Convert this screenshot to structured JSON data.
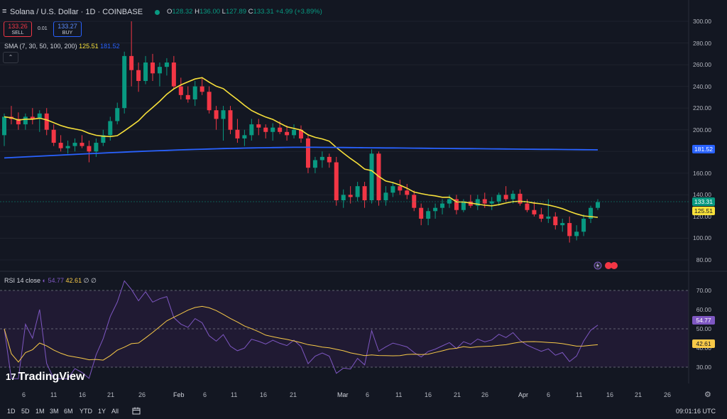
{
  "header": {
    "menu_icon": "≡",
    "title": "Solana / U.S. Dollar · 1D · COINBASE",
    "ohlc": {
      "o_label": "O",
      "o": "128.32",
      "h_label": "H",
      "h": "136.00",
      "l_label": "L",
      "l": "127.89",
      "c_label": "C",
      "c": "133.31",
      "change": "+4.99 (+3.89%)"
    }
  },
  "trade": {
    "sell_price": "133.26",
    "sell_label": "SELL",
    "spread": "0.01",
    "buy_price": "133.27",
    "buy_label": "BUY"
  },
  "sma_legend": {
    "label": "SMA (7, 30, 50, 100, 200)",
    "value1": "125.51",
    "value2": "181.52"
  },
  "rsi_legend": {
    "label": "RSI 14 close",
    "value1": "54.77",
    "value2": "42.61",
    "value3": "∅",
    "value4": "∅"
  },
  "collapse_icon": "⌃",
  "price_axis": [
    "300.00",
    "280.00",
    "260.00",
    "240.00",
    "220.00",
    "200.00",
    "180.00",
    "160.00",
    "140.00",
    "120.00",
    "100.00",
    "80.00"
  ],
  "price_badges": {
    "sma200": "181.52",
    "close": "133.31",
    "sma30": "125.51"
  },
  "rsi_axis": [
    "70.00",
    "60.00",
    "50.00",
    "40.00",
    "30.00"
  ],
  "rsi_badges": {
    "rsi": "54.77",
    "rsi_ma": "42.61"
  },
  "time_axis": [
    "6",
    "11",
    "16",
    "21",
    "26",
    "Feb",
    "6",
    "11",
    "16",
    "21",
    "Mar",
    "6",
    "11",
    "16",
    "21",
    "26",
    "Apr",
    "6",
    "11",
    "16",
    "21",
    "26"
  ],
  "timeframes": [
    "1D",
    "5D",
    "1M",
    "3M",
    "6M",
    "YTD",
    "1Y",
    "All"
  ],
  "calendar_icon": "calendar-range-icon",
  "clock": "09:01:16 UTC",
  "logo": {
    "mark": "17",
    "text": "TradingView"
  },
  "settings_icon": "⚙",
  "colors": {
    "bg": "#131722",
    "up": "#089981",
    "down": "#f23645",
    "sma30": "#f7e03a",
    "sma200": "#2962ff",
    "rsi": "#7e57c2",
    "rsi_ma": "#f7c948"
  },
  "chart_data": {
    "type": "candlestick",
    "title": "Solana / U.S. Dollar · 1D · COINBASE",
    "ylim": [
      70,
      310
    ],
    "candles": [
      [
        195,
        215,
        185,
        212
      ],
      [
        212,
        222,
        205,
        210
      ],
      [
        210,
        216,
        200,
        205
      ],
      [
        205,
        215,
        200,
        212
      ],
      [
        212,
        220,
        205,
        210
      ],
      [
        210,
        218,
        198,
        215
      ],
      [
        215,
        220,
        195,
        200
      ],
      [
        200,
        205,
        185,
        188
      ],
      [
        188,
        195,
        180,
        183
      ],
      [
        183,
        190,
        178,
        185
      ],
      [
        185,
        192,
        180,
        188
      ],
      [
        188,
        195,
        183,
        185
      ],
      [
        185,
        190,
        170,
        180
      ],
      [
        180,
        192,
        175,
        188
      ],
      [
        188,
        200,
        185,
        195
      ],
      [
        195,
        212,
        190,
        208
      ],
      [
        208,
        225,
        205,
        220
      ],
      [
        220,
        272,
        215,
        268
      ],
      [
        268,
        300,
        240,
        255
      ],
      [
        255,
        262,
        235,
        245
      ],
      [
        245,
        268,
        242,
        262
      ],
      [
        262,
        270,
        245,
        252
      ],
      [
        252,
        262,
        240,
        258
      ],
      [
        258,
        266,
        250,
        262
      ],
      [
        262,
        268,
        238,
        240
      ],
      [
        240,
        248,
        228,
        232
      ],
      [
        232,
        240,
        225,
        228
      ],
      [
        228,
        245,
        222,
        240
      ],
      [
        240,
        248,
        232,
        235
      ],
      [
        235,
        240,
        215,
        218
      ],
      [
        218,
        222,
        200,
        210
      ],
      [
        210,
        222,
        190,
        218
      ],
      [
        218,
        222,
        196,
        200
      ],
      [
        200,
        210,
        188,
        192
      ],
      [
        192,
        200,
        185,
        195
      ],
      [
        195,
        210,
        190,
        205
      ],
      [
        205,
        210,
        195,
        202
      ],
      [
        202,
        205,
        192,
        198
      ],
      [
        198,
        206,
        190,
        202
      ],
      [
        202,
        208,
        196,
        198
      ],
      [
        198,
        204,
        190,
        195
      ],
      [
        195,
        205,
        192,
        200
      ],
      [
        200,
        204,
        188,
        192
      ],
      [
        192,
        196,
        160,
        165
      ],
      [
        165,
        175,
        160,
        172
      ],
      [
        172,
        180,
        165,
        175
      ],
      [
        175,
        178,
        165,
        170
      ],
      [
        170,
        175,
        130,
        135
      ],
      [
        135,
        145,
        128,
        140
      ],
      [
        140,
        148,
        132,
        138
      ],
      [
        138,
        152,
        134,
        148
      ],
      [
        148,
        152,
        128,
        135
      ],
      [
        135,
        182,
        132,
        178
      ],
      [
        178,
        180,
        130,
        135
      ],
      [
        135,
        148,
        130,
        142
      ],
      [
        142,
        152,
        138,
        148
      ],
      [
        148,
        154,
        140,
        144
      ],
      [
        144,
        150,
        136,
        140
      ],
      [
        140,
        144,
        125,
        128
      ],
      [
        128,
        132,
        112,
        118
      ],
      [
        118,
        128,
        112,
        125
      ],
      [
        125,
        132,
        118,
        128
      ],
      [
        128,
        136,
        122,
        132
      ],
      [
        132,
        140,
        128,
        136
      ],
      [
        136,
        140,
        122,
        126
      ],
      [
        126,
        136,
        124,
        134
      ],
      [
        134,
        140,
        128,
        130
      ],
      [
        130,
        140,
        126,
        136
      ],
      [
        136,
        142,
        128,
        132
      ],
      [
        132,
        138,
        126,
        134
      ],
      [
        134,
        142,
        130,
        140
      ],
      [
        140,
        148,
        134,
        136
      ],
      [
        136,
        144,
        132,
        141
      ],
      [
        141,
        145,
        130,
        132
      ],
      [
        132,
        136,
        124,
        126
      ],
      [
        126,
        134,
        120,
        122
      ],
      [
        122,
        128,
        115,
        118
      ],
      [
        118,
        136,
        114,
        120
      ],
      [
        120,
        124,
        108,
        112
      ],
      [
        112,
        118,
        106,
        114
      ],
      [
        114,
        120,
        96,
        102
      ],
      [
        102,
        112,
        98,
        106
      ],
      [
        106,
        122,
        102,
        118
      ],
      [
        118,
        130,
        114,
        128
      ],
      [
        128,
        136,
        126,
        133.31
      ]
    ],
    "sma30_last": 125.51,
    "sma200_last": 181.52,
    "rsi": {
      "label": "RSI 14 close",
      "last": 54.77,
      "ma_last": 42.61,
      "levels": [
        70,
        50,
        30
      ]
    }
  }
}
